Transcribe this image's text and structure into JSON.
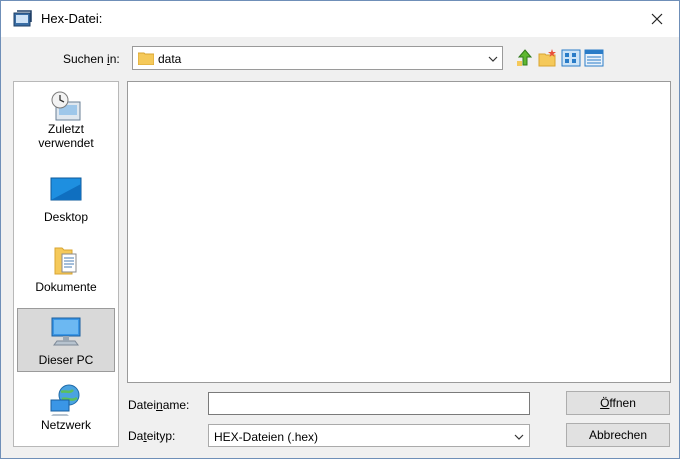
{
  "window": {
    "title": "Hex-Datei:"
  },
  "lookin": {
    "label_pre": "Suchen ",
    "label_u": "i",
    "label_post": "n:",
    "value": "data"
  },
  "places": [
    {
      "line1": "Zuletzt",
      "line2": "verwendet"
    },
    {
      "line1": "Desktop"
    },
    {
      "line1": "Dokumente"
    },
    {
      "line1": "Dieser PC"
    },
    {
      "line1": "Netzwerk"
    }
  ],
  "filename": {
    "label_pre": "Datei",
    "label_u": "n",
    "label_post": "ame:",
    "value": ""
  },
  "filetype": {
    "label_pre": "Da",
    "label_u": "t",
    "label_post": "eityp:",
    "value": "HEX-Dateien (.hex)"
  },
  "buttons": {
    "open_pre": "",
    "open_u": "Ö",
    "open_post": "ffnen",
    "cancel": "Abbrechen"
  },
  "colors": {
    "accent": "#0078d7",
    "selected_place": "#d9d9d9"
  },
  "icons": [
    "dialog-icon",
    "close-icon",
    "folder-icon",
    "chevron-down-icon",
    "up-folder-icon",
    "new-folder-icon",
    "view-menu-icon",
    "recent-icon",
    "desktop-icon",
    "documents-icon",
    "this-pc-icon",
    "network-icon"
  ]
}
